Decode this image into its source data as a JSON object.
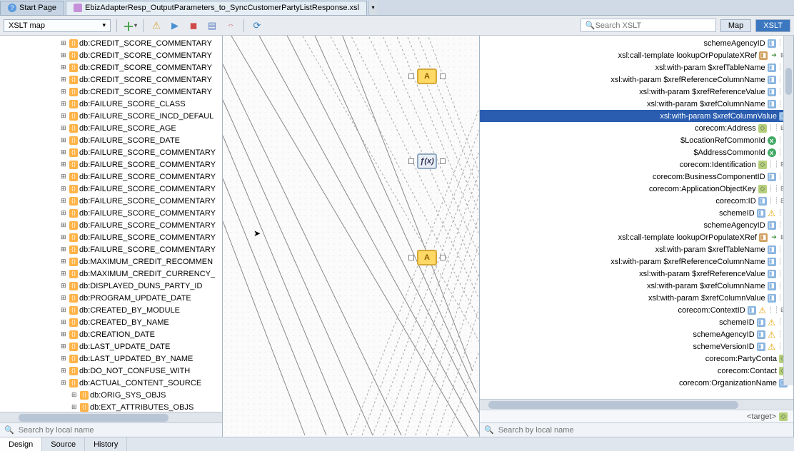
{
  "tabs": {
    "start": "Start Page",
    "editor": "EbizAdapterResp_OutputParameters_to_SyncCustomerPartyListResponse.xsl"
  },
  "toolbar": {
    "dropdown": "XSLT map",
    "search_placeholder": "Search XSLT",
    "map_btn": "Map",
    "xslt_btn": "XSLT"
  },
  "left_tree": [
    "db:CREDIT_SCORE_COMMENTARY",
    "db:CREDIT_SCORE_COMMENTARY",
    "db:CREDIT_SCORE_COMMENTARY",
    "db:CREDIT_SCORE_COMMENTARY",
    "db:CREDIT_SCORE_COMMENTARY",
    "db:FAILURE_SCORE_CLASS",
    "db:FAILURE_SCORE_INCD_DEFAUL",
    "db:FAILURE_SCORE_AGE",
    "db:FAILURE_SCORE_DATE",
    "db:FAILURE_SCORE_COMMENTARY",
    "db:FAILURE_SCORE_COMMENTARY",
    "db:FAILURE_SCORE_COMMENTARY",
    "db:FAILURE_SCORE_COMMENTARY",
    "db:FAILURE_SCORE_COMMENTARY",
    "db:FAILURE_SCORE_COMMENTARY",
    "db:FAILURE_SCORE_COMMENTARY",
    "db:FAILURE_SCORE_COMMENTARY",
    "db:FAILURE_SCORE_COMMENTARY",
    "db:MAXIMUM_CREDIT_RECOMMEN",
    "db:MAXIMUM_CREDIT_CURRENCY_",
    "db:DISPLAYED_DUNS_PARTY_ID",
    "db:PROGRAM_UPDATE_DATE",
    "db:CREATED_BY_MODULE",
    "db:CREATED_BY_NAME",
    "db:CREATION_DATE",
    "db:LAST_UPDATE_DATE",
    "db:LAST_UPDATED_BY_NAME",
    "db:DO_NOT_CONFUSE_WITH",
    "db:ACTUAL_CONTENT_SOURCE"
  ],
  "left_tree_indent": [
    "db:ORIG_SYS_OBJS",
    "db:EXT_ATTRIBUTES_OBJS"
  ],
  "right_tree": [
    {
      "label": "schemeAgencyID",
      "icon": "attr",
      "extras": [
        "guide"
      ]
    },
    {
      "label": "xsl:call-template lookupOrPopulateXRef",
      "icon": "templ",
      "extras": [
        "arrow",
        "collapse"
      ]
    },
    {
      "label": "xsl:with-param $xrefTableName",
      "icon": "attr",
      "extras": [
        "guide"
      ]
    },
    {
      "label": "xsl:with-param $xrefReferenceColumnName",
      "icon": "attr",
      "extras": [
        "guide"
      ]
    },
    {
      "label": "xsl:with-param $xrefReferenceValue",
      "icon": "attr",
      "extras": [
        "guide"
      ]
    },
    {
      "label": "xsl:with-param $xrefColumnName",
      "icon": "attr",
      "extras": [
        "guide"
      ]
    },
    {
      "label": "xsl:with-param $xrefColumnValue",
      "icon": "attr",
      "selected": true
    },
    {
      "label": "corecom:Address",
      "icon": "elem",
      "extras": [
        "guide",
        "collapse"
      ]
    },
    {
      "label": "$LocationRefCommonId",
      "icon": "var",
      "extras": [
        "guide"
      ]
    },
    {
      "label": "$AddressCommonId",
      "icon": "var",
      "extras": [
        "guide"
      ]
    },
    {
      "label": "corecom:Identification",
      "icon": "elem",
      "extras": [
        "guide",
        "collapse"
      ]
    },
    {
      "label": "corecom:BusinessComponentID",
      "icon": "attr",
      "extras": [
        "guide"
      ]
    },
    {
      "label": "corecom:ApplicationObjectKey",
      "icon": "elem",
      "extras": [
        "guide",
        "collapse"
      ]
    },
    {
      "label": "corecom:ID",
      "icon": "attr",
      "extras": [
        "guide",
        "collapse"
      ]
    },
    {
      "label": "schemeID",
      "icon": "attr",
      "extras": [
        "warn",
        "guide"
      ]
    },
    {
      "label": "schemeAgencyID",
      "icon": "attr",
      "extras": [
        "guide"
      ]
    },
    {
      "label": "xsl:call-template lookupOrPopulateXRef",
      "icon": "templ",
      "extras": [
        "arrow",
        "collapse"
      ]
    },
    {
      "label": "xsl:with-param $xrefTableName",
      "icon": "attr",
      "extras": [
        "guide"
      ]
    },
    {
      "label": "xsl:with-param $xrefReferenceColumnName",
      "icon": "attr",
      "extras": [
        "guide"
      ]
    },
    {
      "label": "xsl:with-param $xrefReferenceValue",
      "icon": "attr",
      "extras": [
        "guide"
      ]
    },
    {
      "label": "xsl:with-param $xrefColumnName",
      "icon": "attr",
      "extras": [
        "guide"
      ]
    },
    {
      "label": "xsl:with-param $xrefColumnValue",
      "icon": "attr",
      "extras": [
        "guide"
      ]
    },
    {
      "label": "corecom:ContextID",
      "icon": "attr",
      "extras": [
        "warn",
        "guide",
        "collapse"
      ]
    },
    {
      "label": "schemeID",
      "icon": "attr",
      "extras": [
        "warn",
        "guide"
      ]
    },
    {
      "label": "schemeAgencyID",
      "icon": "attr",
      "extras": [
        "warn",
        "guide"
      ]
    },
    {
      "label": "schemeVersionID",
      "icon": "attr",
      "extras": [
        "warn",
        "guide"
      ]
    },
    {
      "label": "corecom:PartyConta",
      "icon": "elem",
      "extras": []
    },
    {
      "label": "corecom:Contact",
      "icon": "elem",
      "extras": []
    },
    {
      "label": "corecom:OrganizationName",
      "icon": "attr",
      "extras": []
    }
  ],
  "target_label": "<target>",
  "search_local": "Search by local name",
  "bottom_tabs": [
    "Design",
    "Source",
    "History"
  ]
}
